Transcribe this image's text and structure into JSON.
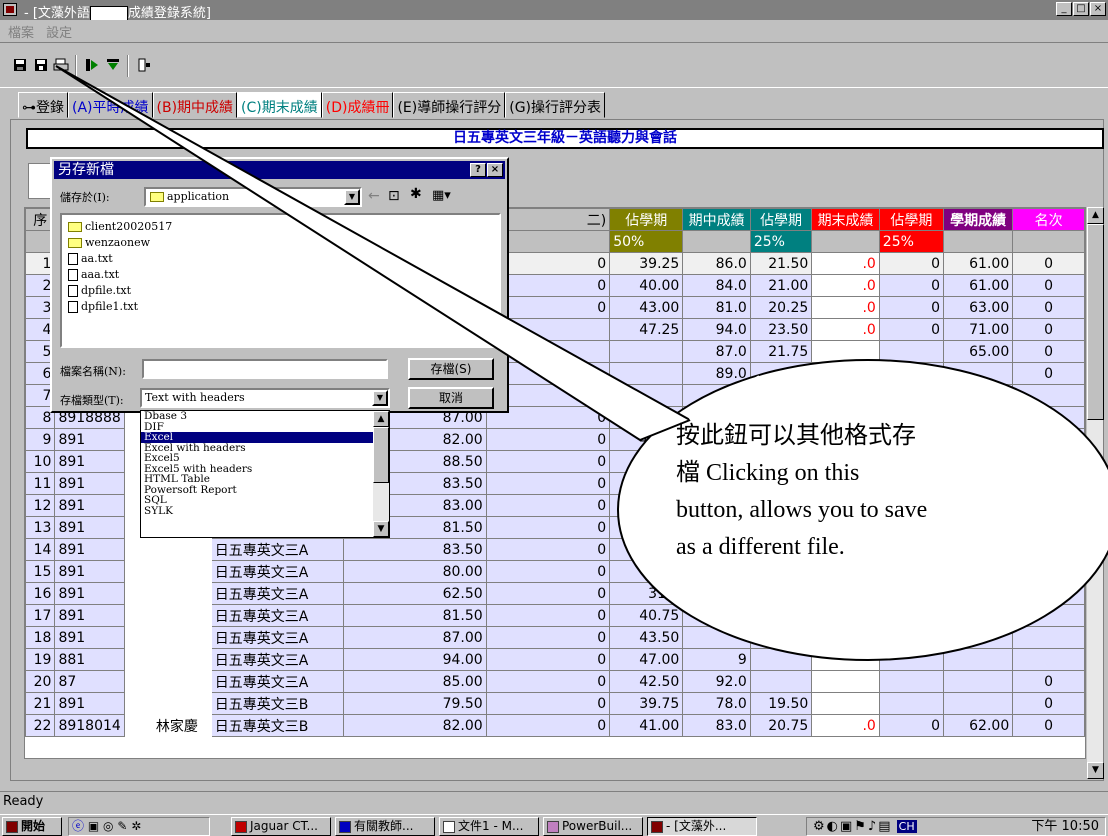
{
  "window": {
    "title_prefix": "- [文藻外語",
    "title_suffix": "成績登錄系統]",
    "controls": [
      "_",
      "□",
      "×"
    ]
  },
  "menu": [
    "檔案",
    "設定"
  ],
  "toolbar": {
    "icons": [
      "save-icon",
      "save-as-icon",
      "print-icon",
      "import-icon",
      "export-icon",
      "exit-icon"
    ]
  },
  "tabs": [
    {
      "label": "⊶登錄",
      "color": "#000000"
    },
    {
      "label": "(A)平時成績",
      "color": "#0000cc"
    },
    {
      "label": "(B)期中成績",
      "color": "#cc0000"
    },
    {
      "label": "(C)期末成績",
      "color": "#008080",
      "active": true
    },
    {
      "label": "(D)成績冊",
      "color": "#ff0000"
    },
    {
      "label": "(E)導師操行評分",
      "color": "#000000"
    },
    {
      "label": "(G)操行評分表",
      "color": "#000000"
    }
  ],
  "class_title": "日五專英文三年級－英語聽力與會話",
  "grid": {
    "headers": {
      "seq": "序",
      "mid": "二)",
      "est1": "佔學期",
      "midterm": "期中成績",
      "est2": "佔學期",
      "final": "期末成績",
      "est3": "佔學期",
      "semester": "學期成績",
      "rank": "名次"
    },
    "percents": {
      "p1": "50%",
      "p2": "25%",
      "p3": "25%"
    },
    "rows": [
      {
        "no": "1",
        "id": "",
        "name": "",
        "cls": "",
        "avg": "",
        "z": "0",
        "est1": "39.25",
        "mid": "86.0",
        "est2": "21.50",
        "fin": ".0",
        "f0": "0",
        "sem": "61.00",
        "rank": "0"
      },
      {
        "no": "2",
        "id": "",
        "name": "",
        "cls": "",
        "avg": "",
        "z": "0",
        "est1": "40.00",
        "mid": "84.0",
        "est2": "21.00",
        "fin": ".0",
        "f0": "0",
        "sem": "61.00",
        "rank": "0"
      },
      {
        "no": "3",
        "id": "",
        "name": "",
        "cls": "",
        "avg": "",
        "z": "0",
        "est1": "43.00",
        "mid": "81.0",
        "est2": "20.25",
        "fin": ".0",
        "f0": "0",
        "sem": "63.00",
        "rank": "0"
      },
      {
        "no": "4",
        "id": "",
        "name": "",
        "cls": "",
        "avg": "",
        "z": "",
        "est1": "47.25",
        "mid": "94.0",
        "est2": "23.50",
        "fin": ".0",
        "f0": "0",
        "sem": "71.00",
        "rank": "0"
      },
      {
        "no": "5",
        "id": "",
        "name": "",
        "cls": "",
        "avg": "",
        "z": "",
        "est1": "",
        "mid": "87.0",
        "est2": "21.75",
        "fin": "",
        "f0": "",
        "sem": "65.00",
        "rank": "0"
      },
      {
        "no": "6",
        "id": "",
        "name": "",
        "cls": "",
        "avg": "",
        "z": "",
        "est1": "",
        "mid": "89.0",
        "est2": "",
        "fin": "",
        "f0": "",
        "sem": "",
        "rank": "0"
      },
      {
        "no": "7",
        "id": "",
        "name": "",
        "cls": "",
        "avg": "",
        "z": "0",
        "est1": "",
        "mid": "",
        "est2": "",
        "fin": "",
        "f0": "",
        "sem": "",
        "rank": ""
      },
      {
        "no": "8",
        "id": "8918888",
        "name": "",
        "cls": "",
        "avg": "87.00",
        "z": "0",
        "est1": "43.",
        "mid": "",
        "est2": "",
        "fin": "",
        "f0": "",
        "sem": "",
        "rank": ""
      },
      {
        "no": "9",
        "id": "891",
        "name": "",
        "cls": "",
        "avg": "82.00",
        "z": "0",
        "est1": "41.00",
        "mid": "",
        "est2": "",
        "fin": "",
        "f0": "",
        "sem": "",
        "rank": ""
      },
      {
        "no": "10",
        "id": "891",
        "name": "",
        "cls": "",
        "avg": "88.50",
        "z": "0",
        "est1": "44.25",
        "mid": "",
        "est2": "",
        "fin": "",
        "f0": "",
        "sem": "",
        "rank": ""
      },
      {
        "no": "11",
        "id": "891",
        "name": "",
        "cls": "",
        "avg": "83.50",
        "z": "0",
        "est1": "41.",
        "mid": "",
        "est2": "",
        "fin": "",
        "f0": "",
        "sem": "",
        "rank": ""
      },
      {
        "no": "12",
        "id": "891",
        "name": "",
        "cls": "",
        "avg": "83.00",
        "z": "0",
        "est1": "41",
        "mid": "",
        "est2": "",
        "fin": "",
        "f0": "",
        "sem": "",
        "rank": ""
      },
      {
        "no": "13",
        "id": "891",
        "name": "",
        "cls": "日五專英文三A",
        "avg": "81.50",
        "z": "0",
        "est1": "40",
        "mid": "",
        "est2": "",
        "fin": "",
        "f0": "",
        "sem": "",
        "rank": ""
      },
      {
        "no": "14",
        "id": "891",
        "name": "",
        "cls": "日五專英文三A",
        "avg": "83.50",
        "z": "0",
        "est1": "41",
        "mid": "",
        "est2": "",
        "fin": "",
        "f0": "",
        "sem": "",
        "rank": ""
      },
      {
        "no": "15",
        "id": "891",
        "name": "",
        "cls": "日五專英文三A",
        "avg": "80.00",
        "z": "0",
        "est1": "40",
        "mid": "",
        "est2": "",
        "fin": "",
        "f0": "",
        "sem": "",
        "rank": ""
      },
      {
        "no": "16",
        "id": "891",
        "name": "",
        "cls": "日五專英文三A",
        "avg": "62.50",
        "z": "0",
        "est1": "31.2",
        "mid": "",
        "est2": "",
        "fin": "",
        "f0": "",
        "sem": "",
        "rank": ""
      },
      {
        "no": "17",
        "id": "891",
        "name": "",
        "cls": "日五專英文三A",
        "avg": "81.50",
        "z": "0",
        "est1": "40.75",
        "mid": "",
        "est2": "",
        "fin": "",
        "f0": "",
        "sem": "",
        "rank": ""
      },
      {
        "no": "18",
        "id": "891",
        "name": "",
        "cls": "日五專英文三A",
        "avg": "87.00",
        "z": "0",
        "est1": "43.50",
        "mid": "",
        "est2": "",
        "fin": "",
        "f0": "",
        "sem": "",
        "rank": ""
      },
      {
        "no": "19",
        "id": "881",
        "name": "",
        "cls": "日五專英文三A",
        "avg": "94.00",
        "z": "0",
        "est1": "47.00",
        "mid": "9",
        "est2": "",
        "fin": "",
        "f0": "",
        "sem": "",
        "rank": ""
      },
      {
        "no": "20",
        "id": "87",
        "name": "",
        "cls": "日五專英文三A",
        "avg": "85.00",
        "z": "0",
        "est1": "42.50",
        "mid": "92.0",
        "est2": "",
        "fin": "",
        "f0": "",
        "sem": "",
        "rank": "0"
      },
      {
        "no": "21",
        "id": "891",
        "name": "",
        "cls": "日五專英文三B",
        "avg": "79.50",
        "z": "0",
        "est1": "39.75",
        "mid": "78.0",
        "est2": "19.50",
        "fin": "",
        "f0": "",
        "sem": "",
        "rank": "0"
      },
      {
        "no": "22",
        "id": "8918014",
        "name": "林家慶",
        "cls": "日五專英文三B",
        "avg": "82.00",
        "z": "0",
        "est1": "41.00",
        "mid": "83.0",
        "est2": "20.75",
        "fin": ".0",
        "f0": "0",
        "sem": "62.00",
        "rank": "0"
      }
    ]
  },
  "dialog": {
    "title": "另存新檔",
    "save_in_label": "儲存於(I):",
    "save_in_value": "application",
    "files": [
      {
        "name": "client20020517",
        "type": "folder"
      },
      {
        "name": "wenzaonew",
        "type": "folder"
      },
      {
        "name": "aa.txt",
        "type": "file"
      },
      {
        "name": "aaa.txt",
        "type": "file"
      },
      {
        "name": "dpfile.txt",
        "type": "file"
      },
      {
        "name": "dpfile1.txt",
        "type": "file"
      }
    ],
    "filename_label": "檔案名稱(N):",
    "filetype_label": "存檔類型(T):",
    "filetype_value": "Text with headers",
    "save_button": "存檔(S)",
    "cancel_button": "取消",
    "type_options": [
      "Dbase 3",
      "DIF",
      "Excel",
      "Excel with headers",
      "Excel5",
      "Excel5 with headers",
      "HTML Table",
      "Powersoft Report",
      "SQL",
      "SYLK"
    ],
    "selected_option": "Excel"
  },
  "callout": {
    "line1": "按此鈕可以其他格式存",
    "line2": "檔 Clicking on this",
    "line3": "button, allows you to save",
    "line4": "as a different file."
  },
  "status": "Ready",
  "taskbar": {
    "start": "開始",
    "tasks": [
      "Jaguar CT...",
      "有關教師...",
      "文件1 - M...",
      "PowerBuil...",
      "- [文藻外..."
    ],
    "clock": "下午 10:50",
    "lang": "CH"
  }
}
